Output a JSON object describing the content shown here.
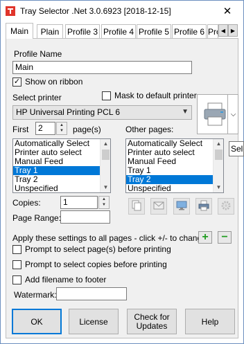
{
  "window": {
    "title": "Tray Selector .Net 3.0.6923 [2018-12-15]",
    "close_glyph": "✕"
  },
  "tabs": [
    "Main",
    "Plain",
    "Profile 3",
    "Profile 4",
    "Profile 5",
    "Profile 6",
    "Pro"
  ],
  "tab_scroll": {
    "left": "◀",
    "right": "▶"
  },
  "main": {
    "profile_name_label": "Profile Name",
    "profile_name_value": "Main",
    "show_on_ribbon_label": "Show on ribbon",
    "show_on_ribbon_checked": true,
    "select_printer_label": "Select printer",
    "mask_default_label": "Mask to default printer",
    "mask_default_checked": false,
    "printer_value": "HP Universal Printing PCL 6",
    "first_label": "First",
    "first_value": "2",
    "pages_label": "page(s)",
    "other_pages_label": "Other pages:",
    "first_list": {
      "items": [
        "Automatically Select",
        "Printer auto select",
        "Manual Feed",
        "Tray 1",
        "Tray 2",
        "Unspecified"
      ],
      "selected_index": 3
    },
    "other_list": {
      "items": [
        "Automatically Select",
        "Printer auto select",
        "Manual Feed",
        "Tray 1",
        "Tray 2",
        "Unspecified"
      ],
      "selected_index": 4
    },
    "copies_label": "Copies:",
    "copies_value": "1",
    "page_range_label": "Page Range:",
    "page_range_value": "",
    "apply_text": "Apply these settings to all pages - click +/- to change",
    "add_glyph": "+",
    "remove_glyph": "−",
    "prompt_pages_label": "Prompt to select page(s) before printing",
    "prompt_copies_label": "Prompt to select copies before printing",
    "add_filename_label": "Add filename to footer",
    "watermark_label": "Watermark:",
    "watermark_value": ""
  },
  "buttons": {
    "ok": "OK",
    "license": "License",
    "check_updates": "Check for Updates",
    "help": "Help"
  },
  "tooltip": "Sele",
  "icons": [
    "printer-icon",
    "copy-icon",
    "envelope-icon",
    "monitor-icon",
    "print-preview-icon",
    "gear-icon"
  ],
  "colors": {
    "selection": "#0078d7",
    "plus_minus": "#1f9c1f"
  }
}
